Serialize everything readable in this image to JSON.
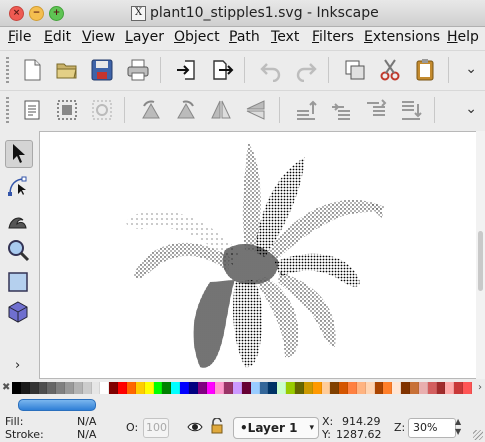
{
  "window": {
    "title": "plant10_stipples1.svg - Inkscape",
    "app_icon": "x11-icon"
  },
  "menu": [
    "File",
    "Edit",
    "View",
    "Layer",
    "Object",
    "Path",
    "Text",
    "Filters",
    "Extensions",
    "Help"
  ],
  "toolbar_commands": [
    "new-document-icon",
    "open-icon",
    "save-icon",
    "print-icon",
    "import-icon",
    "export-icon",
    "undo-icon",
    "redo-icon",
    "duplicate-icon",
    "cut-icon",
    "paste-icon"
  ],
  "toolbar_snap": [
    "document-properties-icon",
    "select-all-icon",
    "deselect-icon",
    "rotate-ccw-icon",
    "rotate-cw-icon",
    "flip-horizontal-icon",
    "flip-vertical-icon",
    "raise-to-top-icon",
    "raise-icon",
    "lower-icon",
    "lower-to-bottom-icon"
  ],
  "tools": [
    "selector-tool-icon",
    "node-tool-icon",
    "tweak-tool-icon",
    "zoom-tool-icon",
    "rectangle-tool-icon",
    "3d-box-tool-icon"
  ],
  "palette": {
    "colors": [
      "#000000",
      "#1a1a1a",
      "#333333",
      "#4d4d4d",
      "#666666",
      "#808080",
      "#999999",
      "#b3b3b3",
      "#cccccc",
      "#e6e6e6",
      "#ffffff",
      "#800000",
      "#ff0000",
      "#ff6600",
      "#ffcc00",
      "#ffff00",
      "#00ff00",
      "#008000",
      "#00ffff",
      "#0000ff",
      "#000080",
      "#800080",
      "#ff00ff",
      "#ff99cc",
      "#993366",
      "#cc99ff",
      "#660033",
      "#99ccff",
      "#336699",
      "#003366",
      "#ccffcc",
      "#99cc00",
      "#666600",
      "#cc9900",
      "#ff9900",
      "#ffcc99",
      "#804000",
      "#d45500",
      "#ff8040",
      "#ffb380",
      "#ffd5b3",
      "#aa4400",
      "#ff7f2a",
      "#ffe6d5",
      "#803300",
      "#c87137",
      "#e9afaf",
      "#d35f5f",
      "#a02c2c",
      "#ffaaaa",
      "#c83737",
      "#ff5555"
    ]
  },
  "status": {
    "fill_label": "Fill:",
    "fill_value": "N/A",
    "stroke_label": "Stroke:",
    "stroke_value": "N/A",
    "opacity_label": "O:",
    "opacity_value": "100",
    "layer_name": "•Layer 1",
    "x_label": "X:",
    "x_value": "914.29",
    "y_label": "Y:",
    "y_value": "1287.62",
    "zoom_label": "Z:",
    "zoom_value": "30%"
  }
}
